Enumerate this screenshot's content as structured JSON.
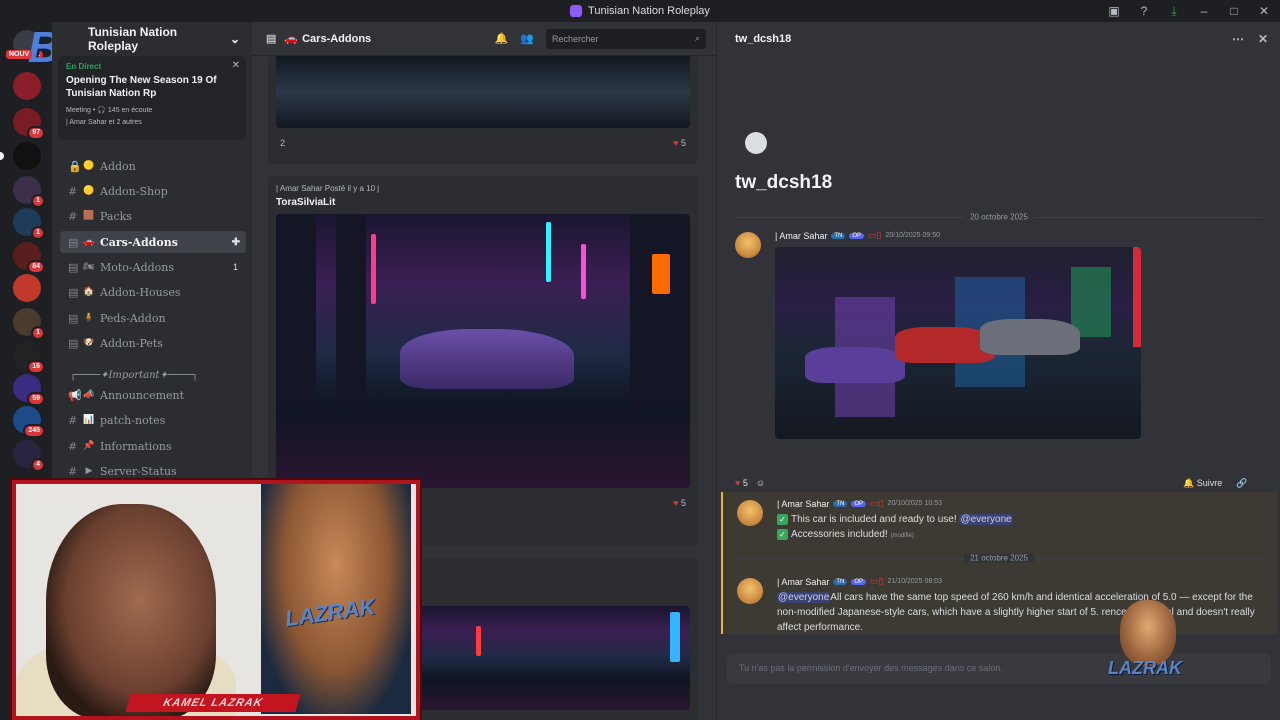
{
  "window": {
    "title": "Tunisian Nation Roleplay"
  },
  "servers": {
    "badges": [
      "1",
      "97",
      "",
      "1",
      "1",
      "84",
      "",
      "1",
      "16",
      "59",
      "245",
      "4"
    ],
    "nouveau_label": "NOUV",
    "brand_overlay": "BAK"
  },
  "guild": {
    "name": "Tunisian Nation Roleplay",
    "live": {
      "tag": "En Direct",
      "title": "Opening The New Season 19 Of Tunisian Nation Rp",
      "meta": "Meeting • 🎧 145 en écoute",
      "users": "| Amar Sahar et 2 autres"
    },
    "channels": [
      {
        "name": "Addon",
        "emoji": "🟡",
        "count": ""
      },
      {
        "name": "Addon-Shop",
        "emoji": "🟡",
        "count": ""
      },
      {
        "name": "Packs",
        "emoji": "🟫",
        "count": ""
      },
      {
        "name": "Cars-Addons",
        "emoji": "🚗",
        "count": ""
      },
      {
        "name": "Moto-Addons",
        "emoji": "🏍",
        "count": "1"
      },
      {
        "name": "Addon-Houses",
        "emoji": "🏠",
        "count": ""
      },
      {
        "name": "Peds-Addon",
        "emoji": "🧍",
        "count": ""
      },
      {
        "name": "Addon-Pets",
        "emoji": "🐶",
        "count": ""
      }
    ],
    "category_important": "┌────✦Important✦────┐",
    "important_channels": [
      {
        "name": "Announcement",
        "emoji": "📣"
      },
      {
        "name": "patch-notes",
        "emoji": "📊"
      },
      {
        "name": "Informations",
        "emoji": "📌"
      },
      {
        "name": "Server-Status",
        "emoji": "▶"
      }
    ]
  },
  "forum": {
    "channel": "Cars-Addons",
    "search_placeholder": "Rechercher",
    "post1": {
      "count_left": "2",
      "count_right": "5"
    },
    "post2": {
      "author": "| Amar Sahar  Posté il y a 10 j",
      "title": "ToraSilviaLit",
      "count_right": "5"
    }
  },
  "thread": {
    "name": "tw_dcsh18",
    "title": "tw_dcsh18",
    "date1": "20 octobre 2025",
    "date2": "21 octobre 2025",
    "msg1": {
      "author": "| Amar Sahar",
      "tag_tn": "TN",
      "tag_op": "OP",
      "time": "20/10/2025 09:50"
    },
    "reactions": {
      "count": "5"
    },
    "follow": "Suivre",
    "msg2": {
      "author": "| Amar Sahar",
      "tag_tn": "TN",
      "tag_op": "OP",
      "time": "20/10/2025 10:53",
      "line1": "This car is included and ready to use!",
      "mention": "@everyone",
      "line2": "Accessories included!",
      "edited": "(modifié)"
    },
    "msg3": {
      "author": "| Amar Sahar",
      "tag_tn": "TN",
      "tag_op": "OP",
      "time": "21/10/2025 08:03",
      "mention": "@everyone",
      "text": "All cars have the same top speed of 260 km/h and identical acceleration of 5.0 — except for the non-modified Japanese-style cars, which have a slightly higher start of 5.",
      "text_tail": "rence is minimal and doesn't really affect performance."
    },
    "composer_placeholder": "Tu n'as pas la permission d'envoyer des messages dans ce salon."
  },
  "overlay": {
    "webcam_banner": "KAMEL LAZRAK",
    "cartoon_label": "LAZRAK",
    "corner_label": "LAZRAK"
  },
  "colors": {
    "accent": "#5865f2",
    "live": "#23a55a",
    "badge": "#da373c",
    "frame": "#b3131c"
  }
}
